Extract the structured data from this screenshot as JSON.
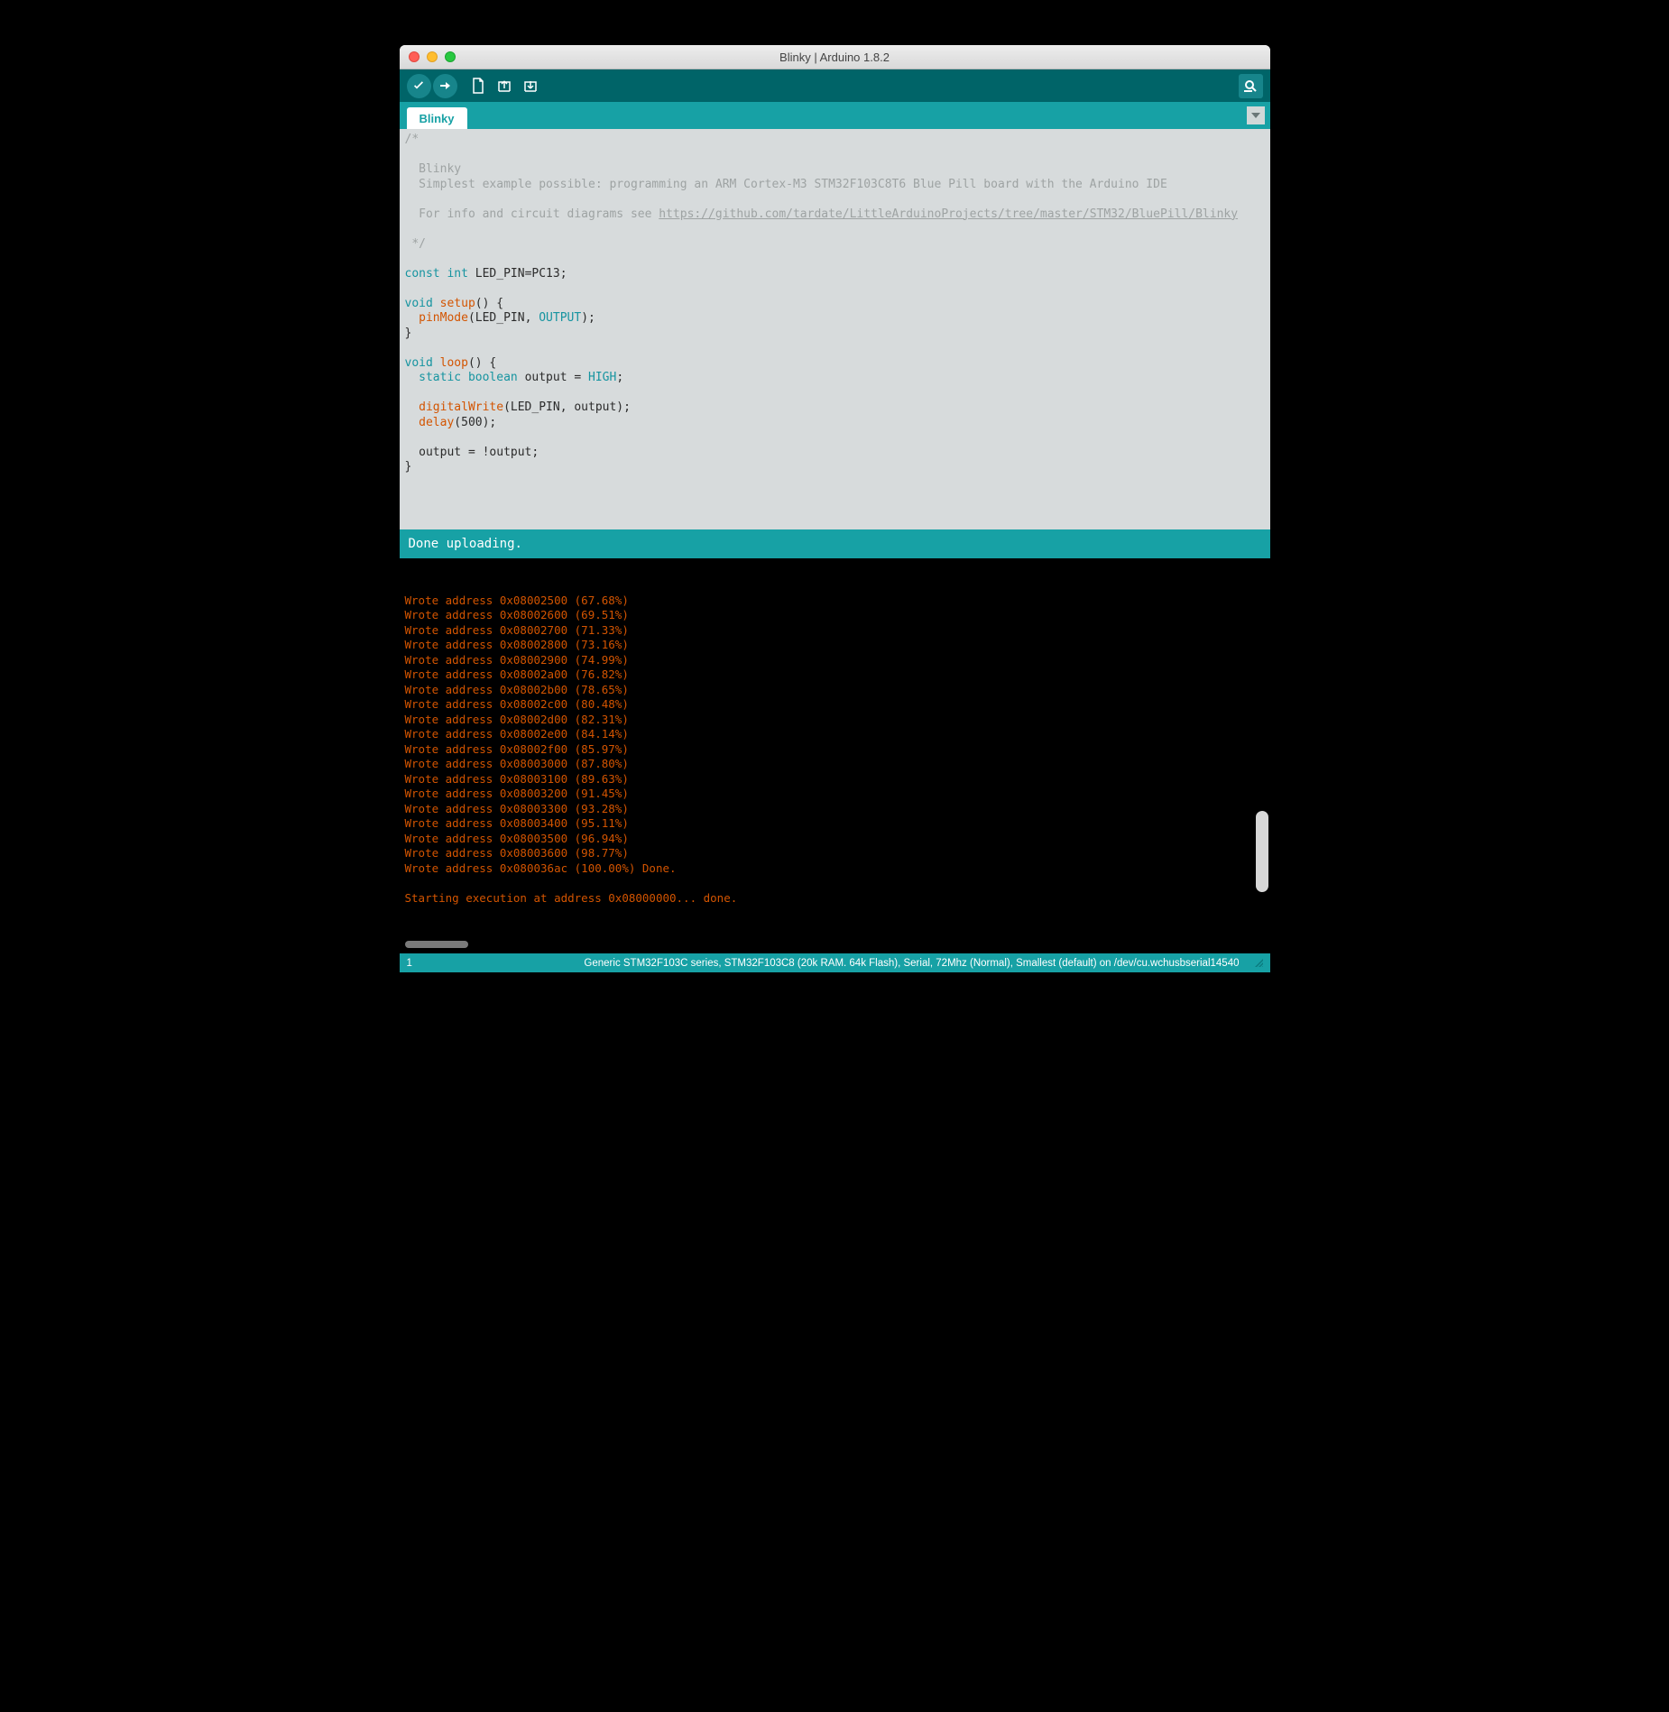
{
  "window": {
    "title": "Blinky | Arduino 1.8.2"
  },
  "tabs": {
    "active": "Blinky"
  },
  "code": {
    "comment_open": "/*",
    "comment_blank": "",
    "comment_title": "  Blinky",
    "comment_desc": "  Simplest example possible: programming an ARM Cortex-M3 STM32F103C8T6 Blue Pill board with the Arduino IDE",
    "comment_info_prefix": "  For info and circuit diagrams see ",
    "comment_link": "https://github.com/tardate/LittleArduinoProjects/tree/master/STM32/BluePill/Blinky",
    "comment_close": " */",
    "const_kw": "const",
    "int_kw": "int",
    "led_decl_rest": " LED_PIN=PC13;",
    "void_kw": "void",
    "setup_name": "setup",
    "setup_open": "() {",
    "pinmode": "pinMode",
    "pinmode_args_open": "(LED_PIN, ",
    "output_const": "OUTPUT",
    "pinmode_args_close": ");",
    "brace_close": "}",
    "loop_name": "loop",
    "loop_open": "() {",
    "static_kw": "static",
    "boolean_kw": "boolean",
    "output_decl": " output = ",
    "high_const": "HIGH",
    "semicolon": ";",
    "digitalwrite": "digitalWrite",
    "digitalwrite_args": "(LED_PIN, output);",
    "delay_fn": "delay",
    "delay_args": "(500);",
    "toggle_line": "  output = !output;"
  },
  "status": {
    "message": "Done uploading."
  },
  "console": {
    "lines": [
      "Wrote address 0x08002500 (67.68%)",
      "Wrote address 0x08002600 (69.51%)",
      "Wrote address 0x08002700 (71.33%)",
      "Wrote address 0x08002800 (73.16%)",
      "Wrote address 0x08002900 (74.99%)",
      "Wrote address 0x08002a00 (76.82%)",
      "Wrote address 0x08002b00 (78.65%)",
      "Wrote address 0x08002c00 (80.48%)",
      "Wrote address 0x08002d00 (82.31%)",
      "Wrote address 0x08002e00 (84.14%)",
      "Wrote address 0x08002f00 (85.97%)",
      "Wrote address 0x08003000 (87.80%)",
      "Wrote address 0x08003100 (89.63%)",
      "Wrote address 0x08003200 (91.45%)",
      "Wrote address 0x08003300 (93.28%)",
      "Wrote address 0x08003400 (95.11%)",
      "Wrote address 0x08003500 (96.94%)",
      "Wrote address 0x08003600 (98.77%)",
      "Wrote address 0x080036ac (100.00%) Done.",
      "",
      "Starting execution at address 0x08000000... done."
    ]
  },
  "footer": {
    "line_number": "1",
    "board_info": "Generic STM32F103C series, STM32F103C8 (20k RAM. 64k Flash), Serial, 72Mhz (Normal), Smallest (default) on /dev/cu.wchusbserial14540"
  },
  "icons": {
    "verify": "verify-icon",
    "upload": "upload-icon",
    "new": "new-sketch-icon",
    "open": "open-sketch-icon",
    "save": "save-sketch-icon",
    "serial": "serial-monitor-icon"
  }
}
